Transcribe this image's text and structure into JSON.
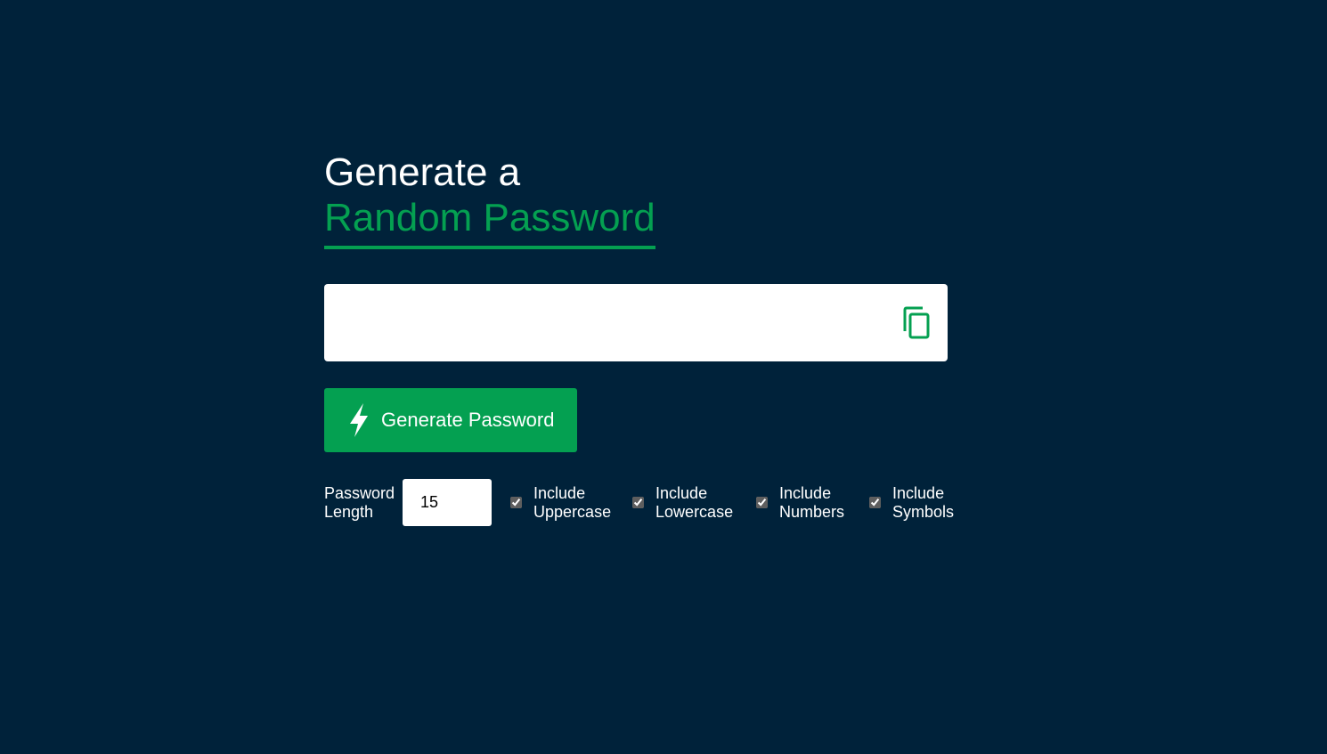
{
  "heading": {
    "line1": "Generate a",
    "line2": "Random Password"
  },
  "output": {
    "value": "",
    "copy_icon": "copy-icon"
  },
  "generate_button": {
    "label": "Generate Password",
    "icon": "lightning-bolt-icon"
  },
  "options": {
    "length_label": "Password Length",
    "length_value": "15",
    "uppercase_label": "Include Uppercase",
    "uppercase_checked": true,
    "lowercase_label": "Include Lowercase",
    "lowercase_checked": true,
    "numbers_label": "Include Numbers",
    "numbers_checked": true,
    "symbols_label": "Include Symbols",
    "symbols_checked": true
  },
  "colors": {
    "background": "#00223a",
    "accent": "#04a051",
    "text": "#ffffff"
  }
}
